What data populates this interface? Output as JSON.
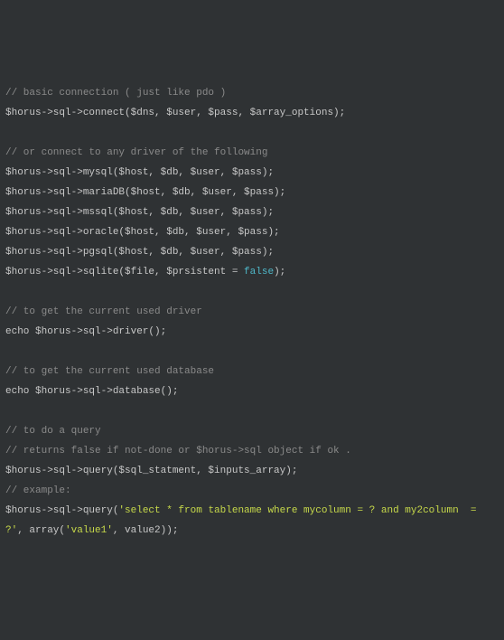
{
  "code": {
    "l01": "// basic connection ( just like pdo )",
    "l02": "$horus->sql->connect($dns, $user, $pass, $array_options);",
    "l03": "",
    "l04": "// or connect to any driver of the following",
    "l05": "$horus->sql->mysql($host, $db, $user, $pass);",
    "l06": "$horus->sql->mariaDB($host, $db, $user, $pass);",
    "l07": "$horus->sql->mssql($host, $db, $user, $pass);",
    "l08": "$horus->sql->oracle($host, $db, $user, $pass);",
    "l09": "$horus->sql->pgsql($host, $db, $user, $pass);",
    "l10a": "$horus->sql->sqlite($file, $prsistent = ",
    "l10b": "false",
    "l10c": ");",
    "l11": "",
    "l12": "// to get the current used driver",
    "l13": "echo $horus->sql->driver();",
    "l14": "",
    "l15": "// to get the current used database",
    "l16": "echo $horus->sql->database();",
    "l17": "",
    "l18": "// to do a query",
    "l19": "// returns false if not-done or $horus->sql object if ok .",
    "l20": "$horus->sql->query($sql_statment, $inputs_array);",
    "l21": "// example:",
    "l22a": "$horus->sql->query(",
    "l22b": "'select * from tablename where mycolumn = ? and my2column  = ?'",
    "l22c": ", array(",
    "l22d": "'value1'",
    "l22e": ", value2));"
  }
}
